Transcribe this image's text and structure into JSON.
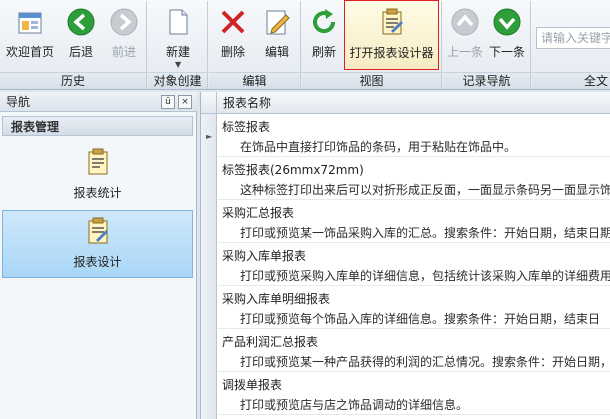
{
  "ribbon": {
    "groups": {
      "home": "历史",
      "create": "对象创建",
      "edit": "编辑",
      "view": "视图",
      "record_nav": "记录导航",
      "fulltext": "全文"
    },
    "buttons": {
      "welcome": "欢迎首页",
      "back": "后退",
      "forward": "前进",
      "new": "新建",
      "delete": "删除",
      "edit": "编辑",
      "refresh": "刷新",
      "open_designer": "打开报表设计器",
      "prev": "上一条",
      "next": "下一条"
    },
    "search_placeholder": "请输入关键字"
  },
  "nav": {
    "title": "导航",
    "pin": "ū",
    "close": "×",
    "section": "报表管理",
    "items": [
      {
        "label": "报表统计"
      },
      {
        "label": "报表设计"
      }
    ]
  },
  "grid": {
    "column": "报表名称",
    "rows": [
      {
        "name": "标签报表",
        "desc": "在饰品中直接打印饰品的条码，用于粘贴在饰品中。"
      },
      {
        "name": "标签报表(26mmx72mm)",
        "desc": "这种标签打印出来后可以对折形成正反面，一面显示条码另一面显示饰"
      },
      {
        "name": "采购汇总报表",
        "desc": "打印或预览某一饰品采购入库的汇总。搜索条件：开始日期，结束日期"
      },
      {
        "name": "采购入库单报表",
        "desc": "打印或预览采购入库单的详细信息，包括统计该采购入库单的详细费用"
      },
      {
        "name": "采购入库单明细报表",
        "desc": "打印或预览每个饰品入库的详细信息。搜索条件：开始日期，结束日"
      },
      {
        "name": "产品利润汇总报表",
        "desc": "打印或预览某一种产品获得的利润的汇总情况。搜索条件：开始日期，"
      },
      {
        "name": "调拨单报表",
        "desc": "打印或预览店与店之饰品调动的详细信息。"
      }
    ]
  },
  "colors": {
    "accent_blue": "#a9d6f7",
    "selection_red": "#e02020",
    "go_green": "#2e9e3a"
  }
}
